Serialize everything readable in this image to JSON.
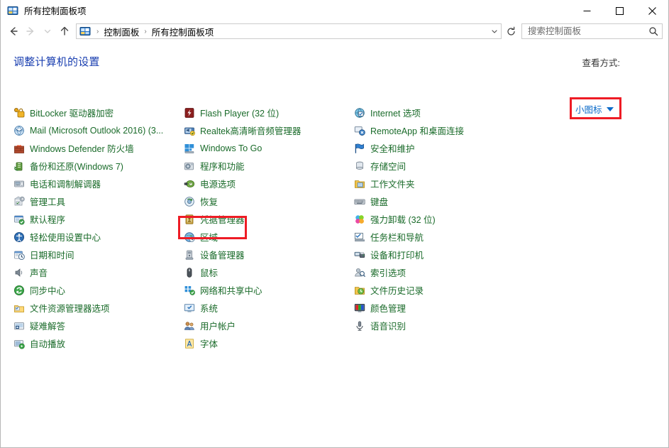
{
  "window": {
    "title": "所有控制面板项",
    "title_icon": "control-panel-icon",
    "caption": {
      "minimize": "─",
      "maximize": "□",
      "close": "✕"
    }
  },
  "nav": {
    "back": "←",
    "forward": "→",
    "recent": "˅",
    "up": "↑",
    "refresh": "↻"
  },
  "address": {
    "icon": "control-panel-icon",
    "crumbs": [
      "控制面板",
      "所有控制面板项"
    ],
    "separator": "›",
    "dropdown": "˅"
  },
  "search": {
    "placeholder": "搜索控制面板",
    "value": "",
    "icon": "search-icon"
  },
  "heading": "调整计算机的设置",
  "view": {
    "label": "查看方式:",
    "value": "小图标",
    "caret": "▼",
    "highlighted": true,
    "highlight_color": "#ee1c25"
  },
  "colors": {
    "link_green": "#1a6b2a",
    "heading_blue": "#1a3fb0",
    "view_blue": "#0b6bc9",
    "highlight_red": "#ee1c25"
  },
  "highlighted_item": "电源选项",
  "columns": [
    {
      "items": [
        {
          "label": "BitLocker 驱动器加密",
          "icon": "bitlocker-icon"
        },
        {
          "label": "Mail (Microsoft Outlook 2016) (3...",
          "icon": "mail-icon"
        },
        {
          "label": "Windows Defender 防火墙",
          "icon": "firewall-icon"
        },
        {
          "label": "备份和还原(Windows 7)",
          "icon": "backup-restore-icon"
        },
        {
          "label": "电话和调制解调器",
          "icon": "phone-modem-icon"
        },
        {
          "label": "管理工具",
          "icon": "admin-tools-icon"
        },
        {
          "label": "默认程序",
          "icon": "default-programs-icon"
        },
        {
          "label": "轻松使用设置中心",
          "icon": "ease-of-access-icon"
        },
        {
          "label": "日期和时间",
          "icon": "date-time-icon"
        },
        {
          "label": "声音",
          "icon": "sound-icon"
        },
        {
          "label": "同步中心",
          "icon": "sync-center-icon"
        },
        {
          "label": "文件资源管理器选项",
          "icon": "file-explorer-options-icon"
        },
        {
          "label": "疑难解答",
          "icon": "troubleshooting-icon"
        },
        {
          "label": "自动播放",
          "icon": "autoplay-icon"
        }
      ]
    },
    {
      "items": [
        {
          "label": "Flash Player (32 位)",
          "icon": "flash-player-icon"
        },
        {
          "label": "Realtek高清晰音频管理器",
          "icon": "realtek-audio-icon"
        },
        {
          "label": "Windows To Go",
          "icon": "windows-to-go-icon"
        },
        {
          "label": "程序和功能",
          "icon": "programs-features-icon"
        },
        {
          "label": "电源选项",
          "icon": "power-options-icon"
        },
        {
          "label": "恢复",
          "icon": "recovery-icon"
        },
        {
          "label": "凭据管理器",
          "icon": "credential-manager-icon"
        },
        {
          "label": "区域",
          "icon": "region-icon"
        },
        {
          "label": "设备管理器",
          "icon": "device-manager-icon"
        },
        {
          "label": "鼠标",
          "icon": "mouse-icon"
        },
        {
          "label": "网络和共享中心",
          "icon": "network-sharing-icon"
        },
        {
          "label": "系统",
          "icon": "system-icon"
        },
        {
          "label": "用户帐户",
          "icon": "user-accounts-icon"
        },
        {
          "label": "字体",
          "icon": "fonts-icon"
        }
      ]
    },
    {
      "items": [
        {
          "label": "Internet 选项",
          "icon": "internet-options-icon"
        },
        {
          "label": "RemoteApp 和桌面连接",
          "icon": "remoteapp-icon"
        },
        {
          "label": "安全和维护",
          "icon": "security-maintenance-icon"
        },
        {
          "label": "存储空间",
          "icon": "storage-spaces-icon"
        },
        {
          "label": "工作文件夹",
          "icon": "work-folders-icon"
        },
        {
          "label": "键盘",
          "icon": "keyboard-icon"
        },
        {
          "label": "强力卸载 (32 位)",
          "icon": "uninstaller-icon"
        },
        {
          "label": "任务栏和导航",
          "icon": "taskbar-navigation-icon"
        },
        {
          "label": "设备和打印机",
          "icon": "devices-printers-icon"
        },
        {
          "label": "索引选项",
          "icon": "indexing-options-icon"
        },
        {
          "label": "文件历史记录",
          "icon": "file-history-icon"
        },
        {
          "label": "颜色管理",
          "icon": "color-management-icon"
        },
        {
          "label": "语音识别",
          "icon": "speech-recognition-icon"
        }
      ]
    }
  ]
}
